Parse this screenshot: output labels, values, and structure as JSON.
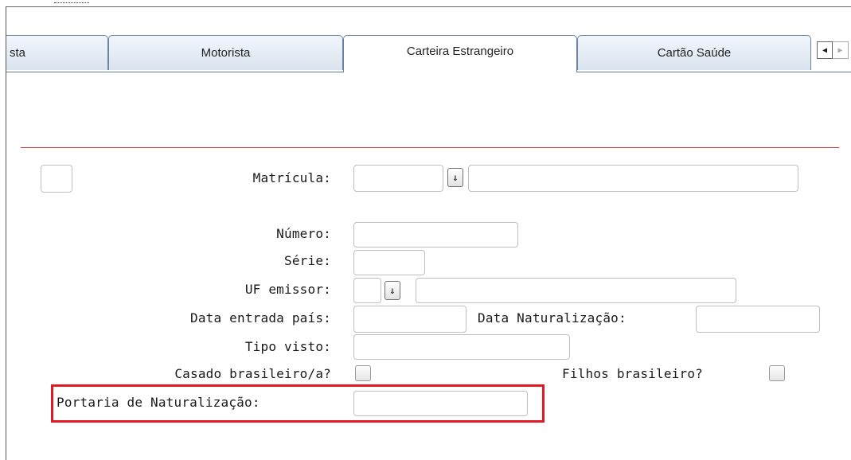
{
  "tabs": [
    {
      "label": "sta",
      "active": false
    },
    {
      "label": "Motorista",
      "active": false
    },
    {
      "label": "Carteira Estrangeiro",
      "active": true
    },
    {
      "label": "Cartão Saúde",
      "active": false
    }
  ],
  "tab_nav": {
    "prev_icon": "◀",
    "next_icon": "▶"
  },
  "form": {
    "matricula_label": "Matrícula:",
    "numero_label": "Número:",
    "serie_label": "Série:",
    "uf_emissor_label": "UF emissor:",
    "data_entrada_label": "Data entrada país:",
    "data_naturalizacao_label": "Data Naturalização:",
    "tipo_visto_label": "Tipo visto:",
    "casado_label": "Casado brasileiro/a?",
    "filhos_label": "Filhos brasileiro?",
    "portaria_label": "Portaria de Naturalização:",
    "lookup_icon": "⇓"
  },
  "colors": {
    "highlight": "#e01b24",
    "separator": "#d23a3a",
    "tab_border": "#6b84a4"
  }
}
